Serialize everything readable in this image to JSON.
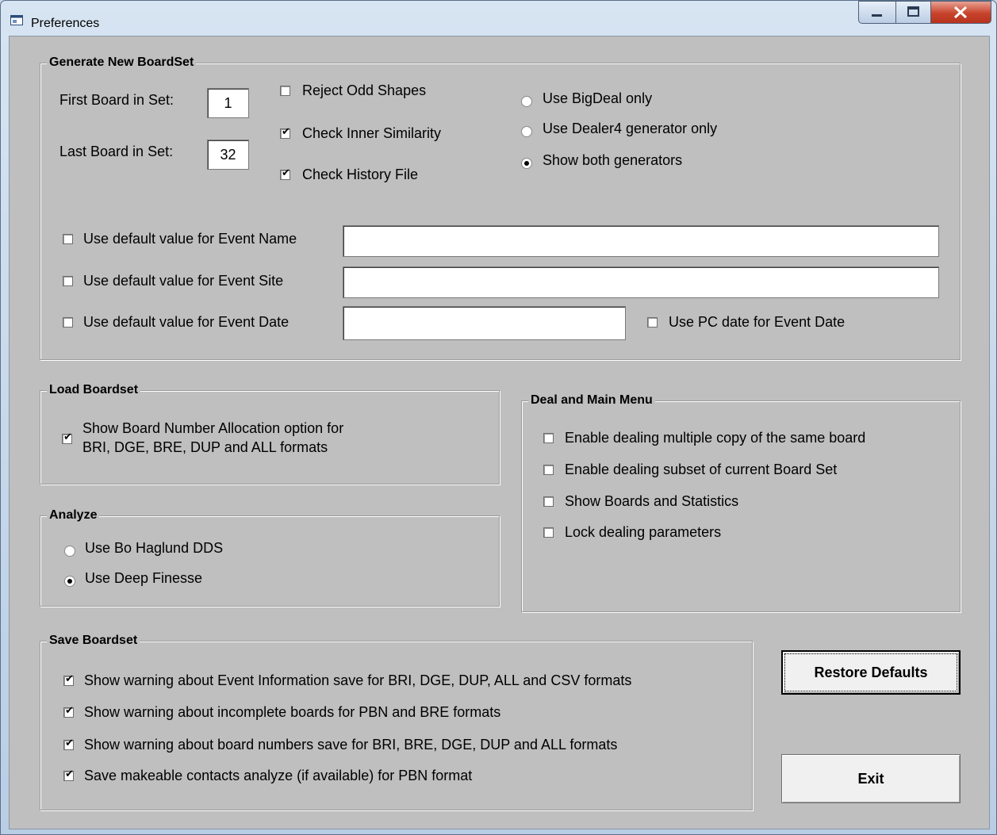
{
  "window": {
    "title": "Preferences"
  },
  "generate": {
    "legend": "Generate New BoardSet",
    "first_label": "First Board in Set:",
    "first_value": "1",
    "last_label": "Last Board in Set:",
    "last_value": "32",
    "reject_odd": {
      "label": "Reject Odd Shapes",
      "checked": false
    },
    "check_inner": {
      "label": "Check Inner Similarity",
      "checked": true
    },
    "check_history": {
      "label": "Check History File",
      "checked": true
    },
    "gen_options": [
      {
        "label": "Use BigDeal only",
        "selected": false
      },
      {
        "label": "Use Dealer4 generator only",
        "selected": false
      },
      {
        "label": "Show both generators",
        "selected": true
      }
    ],
    "event_name": {
      "label": "Use default value for Event Name",
      "checked": false,
      "value": ""
    },
    "event_site": {
      "label": "Use default value for Event Site",
      "checked": false,
      "value": ""
    },
    "event_date": {
      "label": "Use default value for Event Date",
      "checked": false,
      "value": ""
    },
    "pc_date": {
      "label": "Use PC date for Event Date",
      "checked": false
    }
  },
  "load": {
    "legend": "Load Boardset",
    "show_alloc_line1": "Show Board Number Allocation option for",
    "show_alloc_line2": "BRI, DGE, BRE, DUP and ALL formats",
    "show_alloc_checked": true
  },
  "analyze": {
    "legend": "Analyze",
    "options": [
      {
        "label": "Use Bo Haglund DDS",
        "selected": false
      },
      {
        "label": "Use Deep Finesse",
        "selected": true
      }
    ]
  },
  "deal": {
    "legend": "Deal and Main Menu",
    "items": [
      {
        "label": "Enable dealing multiple copy of the same board",
        "checked": false
      },
      {
        "label": "Enable dealing subset of current Board Set",
        "checked": false
      },
      {
        "label": "Show Boards and Statistics",
        "checked": false
      },
      {
        "label": "Lock dealing parameters",
        "checked": false
      }
    ]
  },
  "save": {
    "legend": "Save Boardset",
    "items": [
      {
        "label": "Show warning about Event Information save for BRI, DGE, DUP, ALL and CSV formats",
        "checked": true
      },
      {
        "label": "Show warning about incomplete boards for PBN and BRE  formats",
        "checked": true
      },
      {
        "label": "Show warning about board numbers save for BRI, BRE, DGE, DUP and ALL formats",
        "checked": true
      },
      {
        "label": "Save makeable contacts analyze (if available) for PBN format",
        "checked": true
      }
    ]
  },
  "buttons": {
    "restore": "Restore Defaults",
    "exit": "Exit"
  },
  "icons": {
    "check": "✔",
    "radio_dot": "•"
  }
}
